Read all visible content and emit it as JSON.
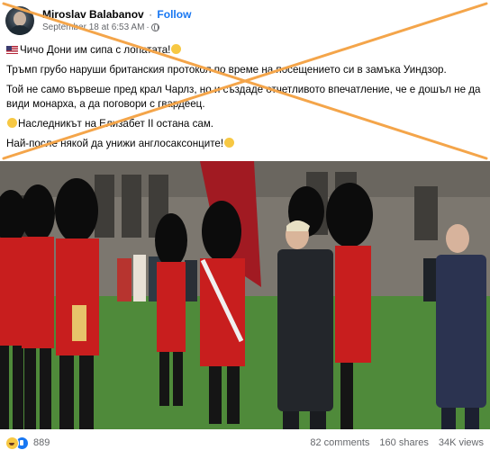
{
  "post": {
    "author": "Miroslav Balabanov",
    "separator": "·",
    "follow_label": "Follow",
    "timestamp": "September 18 at 6:53 AM",
    "time_separator": "·",
    "privacy_icon": "globe-icon"
  },
  "body": {
    "line1": "Чичо Дони им сипа с лопатата!",
    "line2": "Тръмп грубо наруши британския протокол по време на посещението си в замъка Уиндзор.",
    "line3": "Той не само вървеше пред крал Чарлз, но и създаде отчетливото впечатление, че е дошъл не да види монарха, а да поговори с гвардеец.",
    "line4": "Наследникът на Елизабет II остана сам.",
    "line5": "Най-после някой да унижи англосаксонците!"
  },
  "footer": {
    "reaction_count": "889",
    "comments": "82 comments",
    "shares": "160 shares",
    "views": "34K views"
  },
  "colors": {
    "accent": "#1877f2",
    "cross": "#f4a54a",
    "secondary_text": "#65676b",
    "guard_red": "#c81e1e",
    "lawn": "#4f8a3a"
  }
}
